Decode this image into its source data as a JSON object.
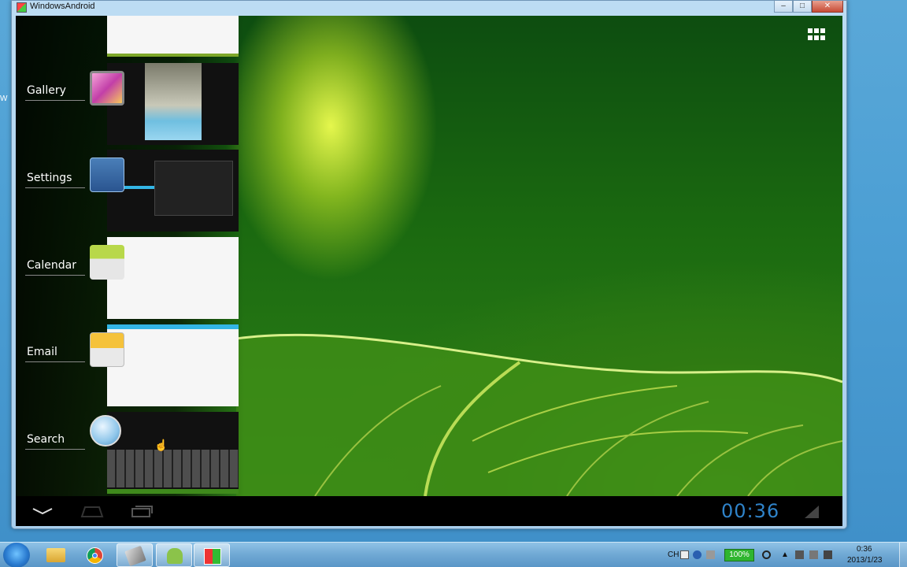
{
  "window": {
    "title": "WindowsAndroid",
    "min_label": "–",
    "max_label": "□",
    "close_label": "✕"
  },
  "recents": [
    {
      "label": "Gallery",
      "icon": "gallery-icon"
    },
    {
      "label": "Settings",
      "icon": "settings-icon"
    },
    {
      "label": "Calendar",
      "icon": "calendar-icon"
    },
    {
      "label": "Email",
      "icon": "email-icon"
    },
    {
      "label": "Search",
      "icon": "search-icon"
    }
  ],
  "navbar": {
    "clock": "00:36"
  },
  "taskbar": {
    "apps": [
      "explorer-icon",
      "chrome-icon",
      "tool-icon",
      "android-icon",
      "windowsandroid-icon"
    ],
    "ime": "CH",
    "battery": "100%",
    "time": "0:36",
    "date": "2013/1/23"
  },
  "colors": {
    "clock": "#2f83c9",
    "taskbar": "#6fa8d4",
    "battery": "#2fb52f"
  }
}
